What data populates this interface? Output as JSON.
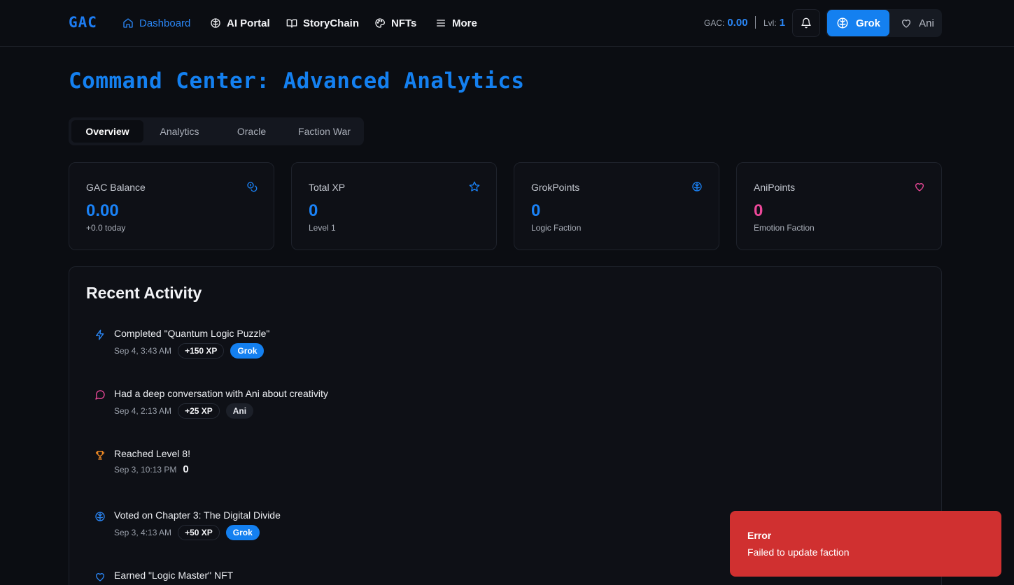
{
  "nav": {
    "logo": "GAC",
    "links": [
      {
        "label": "Dashboard",
        "icon": "home-icon"
      },
      {
        "label": "AI Portal",
        "icon": "brain-icon"
      },
      {
        "label": "StoryChain",
        "icon": "book-icon"
      },
      {
        "label": "NFTs",
        "icon": "palette-icon"
      },
      {
        "label": "More",
        "icon": "menu-icon"
      }
    ],
    "gac_label": "GAC:",
    "gac_value": "0.00",
    "lvl_label": "Lvl:",
    "lvl_value": "1",
    "faction_toggle": {
      "grok": "Grok",
      "ani": "Ani"
    }
  },
  "page": {
    "title": "Command Center: Advanced Analytics"
  },
  "tabs": [
    {
      "label": "Overview",
      "active": true
    },
    {
      "label": "Analytics",
      "active": false
    },
    {
      "label": "Oracle",
      "active": false
    },
    {
      "label": "Faction War",
      "active": false
    }
  ],
  "cards": [
    {
      "label": "GAC Balance",
      "value": "0.00",
      "sub": "+0.0 today",
      "icon": "coins-icon",
      "color": "#1a82f6"
    },
    {
      "label": "Total XP",
      "value": "0",
      "sub": "Level 1",
      "icon": "star-icon",
      "color": "#1a82f6"
    },
    {
      "label": "GrokPoints",
      "value": "0",
      "sub": "Logic Faction",
      "icon": "brain-icon",
      "color": "#1a82f6"
    },
    {
      "label": "AniPoints",
      "value": "0",
      "sub": "Emotion Faction",
      "icon": "heart-icon",
      "color": "#ec4899"
    }
  ],
  "activity": {
    "title": "Recent Activity",
    "items": [
      {
        "text": "Completed \"Quantum Logic Puzzle\"",
        "time": "Sep 4, 3:43 AM",
        "xp": "+150 XP",
        "faction": "Grok",
        "icon": "lightning-icon"
      },
      {
        "text": "Had a deep conversation with Ani about creativity",
        "time": "Sep 4, 2:13 AM",
        "xp": "+25 XP",
        "faction": "Ani",
        "icon": "chat-bubble-icon"
      },
      {
        "text": "Reached Level 8!",
        "time": "Sep 3, 10:13 PM",
        "extra": "0",
        "icon": "trophy-icon"
      },
      {
        "text": "Voted on Chapter 3: The Digital Divide",
        "time": "Sep 3, 4:13 AM",
        "xp": "+50 XP",
        "faction": "Grok",
        "icon": "brain-icon"
      },
      {
        "text": "Earned \"Logic Master\" NFT",
        "icon": "heart-icon"
      }
    ]
  },
  "toast": {
    "title": "Error",
    "message": "Failed to update faction"
  }
}
